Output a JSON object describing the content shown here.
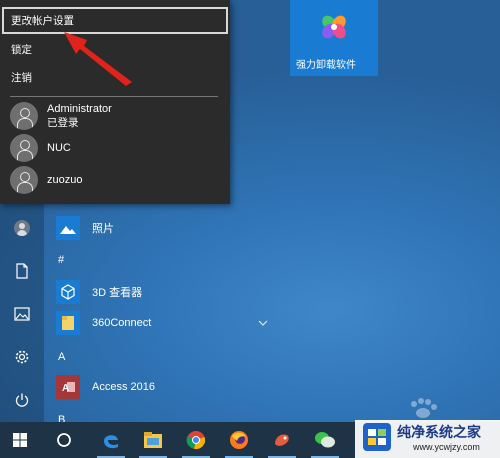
{
  "account_menu": {
    "items": [
      {
        "label": "更改帐户设置"
      },
      {
        "label": "锁定"
      },
      {
        "label": "注销"
      }
    ],
    "users": [
      {
        "name": "Administrator",
        "status": "已登录"
      },
      {
        "name": "NUC",
        "status": ""
      },
      {
        "name": "zuozuo",
        "status": ""
      }
    ]
  },
  "tile": {
    "label": "强力卸载软件",
    "color": "#1a7bd3"
  },
  "apps": {
    "top_app": {
      "label": "照片"
    },
    "groups": [
      {
        "letter": "#",
        "items": [
          {
            "label": "3D 查看器"
          },
          {
            "label": "360Connect"
          }
        ]
      },
      {
        "letter": "A",
        "items": [
          {
            "label": "Access 2016"
          }
        ]
      },
      {
        "letter": "B",
        "items": []
      }
    ]
  },
  "rail_icons": [
    "user-icon",
    "document-icon",
    "pictures-icon",
    "settings-icon",
    "power-icon"
  ],
  "taskbar": {
    "icons": [
      "windows-start-icon",
      "cortana-search-icon",
      "edge-icon",
      "file-explorer-icon",
      "chrome-icon",
      "firefox-icon",
      "app-icon",
      "wechat-icon"
    ]
  },
  "watermark": {
    "title": "纯净系统之家",
    "url": "www.ycwjzy.com"
  },
  "colors": {
    "accent": "#1a7bd3",
    "annotation": "#e0241b",
    "taskbar": "#1f3346"
  }
}
